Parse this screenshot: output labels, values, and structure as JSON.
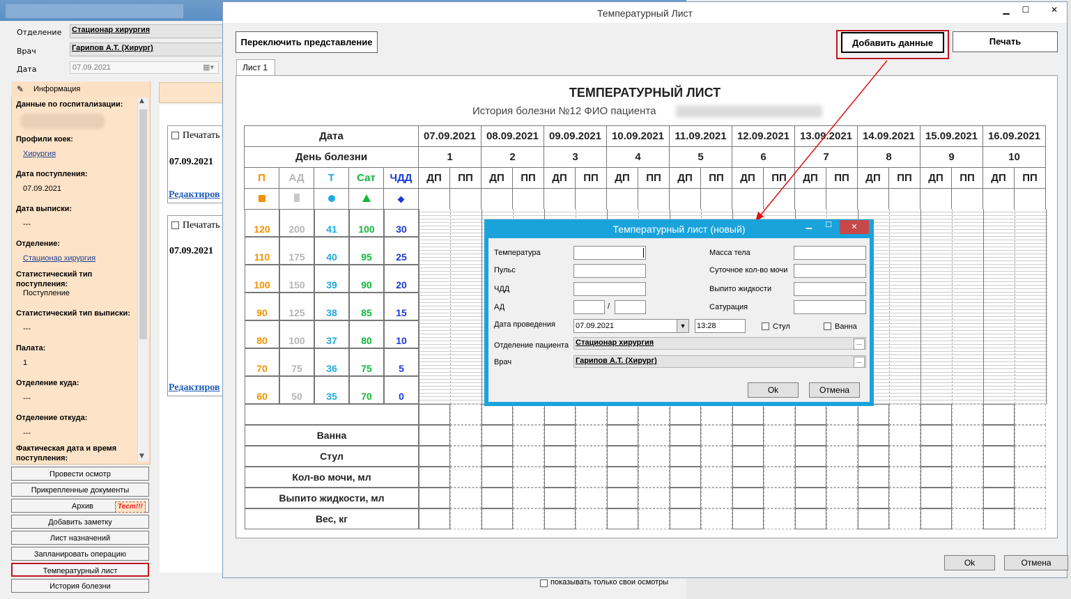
{
  "bg": {
    "dept_label": "Отделение",
    "dept_value": "Стационар хирургия",
    "doctor_label": "Врач",
    "doctor_value": "Гарипов А.Т. (Хирург)",
    "date_label": "Дата",
    "date_value": "07.09.2021",
    "info_header": "Информация",
    "info_items": [
      {
        "label": "Данные по госпитализации:",
        "value": ""
      },
      {
        "label": "Профили коек:",
        "value": "Хирургия"
      },
      {
        "label": "Дата поступления:",
        "value": "07.09.2021"
      },
      {
        "label": "Дата выписки:",
        "value": "---"
      },
      {
        "label": "Отделение:",
        "value": "Стационар хирургия"
      },
      {
        "label": "Статистический тип поступления:",
        "value": "Поступление"
      },
      {
        "label": "Статистический тип выписки:",
        "value": "---"
      },
      {
        "label": "Палата:",
        "value": "1"
      },
      {
        "label": "Отделение куда:",
        "value": "---"
      },
      {
        "label": "Отделение откуда:",
        "value": "---"
      },
      {
        "label": "Фактическая дата и время поступления:",
        "value": ""
      }
    ],
    "buttons": [
      "Провести осмотр",
      "Прикрепленные документы",
      "Архив",
      "Добавить заметку",
      "Лист назначений",
      "Запланировать операцию",
      "Температурный лист",
      "История болезни"
    ],
    "archive_badge": "Тест!!!",
    "print_label": "Печатать",
    "card_date": "07.09.2021",
    "edit_link": "Редактиров",
    "own_only": "показывать только свои осмотры"
  },
  "main": {
    "title": "Температурный Лист",
    "switch_btn": "Переключить представление",
    "add_btn": "Добавить данные",
    "print_btn": "Печать",
    "tab": "Лист 1",
    "sheet_title": "ТЕМПЕРАТУРНЫЙ ЛИСТ",
    "sheet_sub": "История болезни №12 ФИО пациента",
    "ok": "Ok",
    "cancel": "Отмена",
    "row_date": "Дата",
    "row_day": "День болезни",
    "dates": [
      "07.09.2021",
      "08.09.2021",
      "09.09.2021",
      "10.09.2021",
      "11.09.2021",
      "12.09.2021",
      "13.09.2021",
      "14.09.2021",
      "15.09.2021",
      "16.09.2021"
    ],
    "days": [
      "1",
      "2",
      "3",
      "4",
      "5",
      "6",
      "7",
      "8",
      "9",
      "10"
    ],
    "dp": "ДП",
    "pp": "ПП",
    "legend": [
      "П",
      "АД",
      "Т",
      "Сат",
      "ЧДД"
    ],
    "legend_colors": [
      "#f29200",
      "#b4b4b4",
      "#1fa9e1",
      "#10b73a",
      "#1839d6"
    ],
    "legend_icons": [
      "square",
      "bar",
      "circle",
      "triangle",
      "diamond"
    ],
    "scale": {
      "P": [
        "120",
        "110",
        "100",
        "90",
        "80",
        "70",
        "60"
      ],
      "AD": [
        "200",
        "175",
        "150",
        "125",
        "100",
        "75",
        "50"
      ],
      "T": [
        "41",
        "40",
        "39",
        "38",
        "37",
        "36",
        "35"
      ],
      "Sat": [
        "100",
        "95",
        "90",
        "85",
        "80",
        "75",
        "70"
      ],
      "CHDD": [
        "30",
        "25",
        "20",
        "15",
        "10",
        "5",
        "0"
      ]
    },
    "bottom_rows": [
      "Ванна",
      "Стул",
      "Кол-во мочи, мл",
      "Выпито жидкости, мл",
      "Вес, кг"
    ]
  },
  "dialog": {
    "title": "Температурный лист (новый)",
    "temp": "Температура",
    "pulse": "Пульс",
    "chdd": "ЧДД",
    "ad": "АД",
    "date_label": "Дата проведения",
    "date_value": "07.09.2021",
    "time_value": "13:28",
    "dept_label": "Отделение пациента",
    "dept_value": "Стационар хирургия",
    "doctor_label": "Врач",
    "doctor_value": "Гарипов А.Т. (Хирург)",
    "mass": "Масса тела",
    "urine": "Суточное кол-во мочи",
    "drink": "Выпито жидкости",
    "sat": "Сатурация",
    "stool": "Стул",
    "bath": "Ванна",
    "ok": "Ok",
    "cancel": "Отмена"
  }
}
